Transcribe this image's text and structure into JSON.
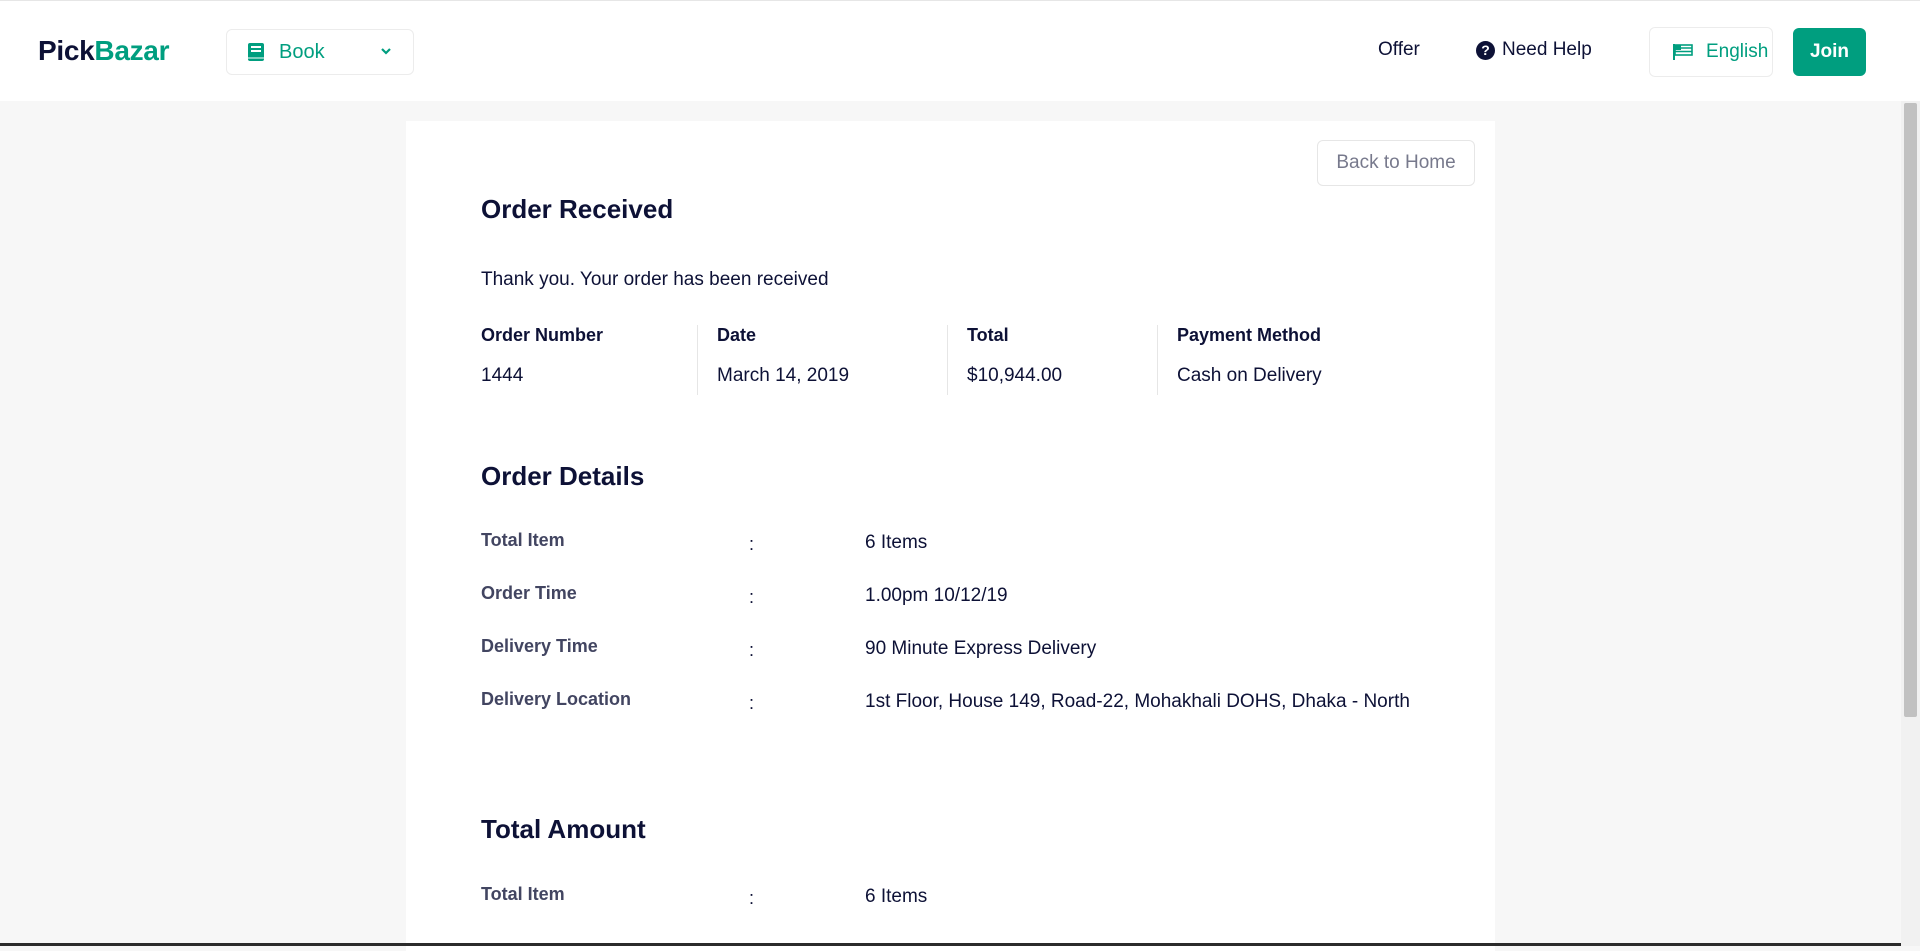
{
  "header": {
    "logo_part1": "Pick",
    "logo_part2": "Bazar",
    "type_selector": {
      "label": "Book",
      "icon": "book-icon",
      "chevron_icon": "chevron-down-icon"
    },
    "nav": {
      "offer": "Offer",
      "help": "Need Help",
      "help_icon": "question-circle-icon"
    },
    "language": {
      "label": "English",
      "icon": "flag-icon"
    },
    "join": "Join"
  },
  "order": {
    "back_home": "Back to Home",
    "received_title": "Order Received",
    "thanks_message": "Thank you. Your order has been received",
    "info": [
      {
        "label": "Order Number",
        "value": "1444"
      },
      {
        "label": "Date",
        "value": "March 14, 2019"
      },
      {
        "label": "Total",
        "value": "$10,944.00"
      },
      {
        "label": "Payment Method",
        "value": "Cash on Delivery"
      }
    ],
    "details_title": "Order Details",
    "details": [
      {
        "label": "Total Item",
        "value": "6 Items"
      },
      {
        "label": "Order Time",
        "value": "1.00pm 10/12/19"
      },
      {
        "label": "Delivery Time",
        "value": "90 Minute Express Delivery"
      },
      {
        "label": "Delivery Location",
        "value": "1st Floor, House 149, Road-22, Mohakhali DOHS, Dhaka - North"
      }
    ],
    "total_title": "Total Amount",
    "totals": [
      {
        "label": "Total Item",
        "value": "6 Items"
      }
    ],
    "separator": ":"
  },
  "colors": {
    "brand": "#009e7f",
    "heading": "#0d1136",
    "muted": "#77798c"
  }
}
